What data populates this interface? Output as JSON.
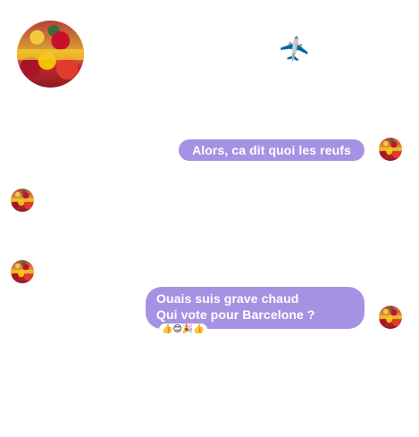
{
  "header": {
    "group_avatar": "group-photo-spain-fans",
    "status_icon": "airplane-icon",
    "status_glyph": "✈️"
  },
  "messages": [
    {
      "side": "right",
      "avatar": "user-photo-spain-fans",
      "lines": [
        "Alors, ca dit quoi les reufs"
      ]
    },
    {
      "side": "left",
      "avatar": "user-photo-spain-fans",
      "lines": []
    },
    {
      "side": "left",
      "avatar": "user-photo-spain-fans",
      "lines": []
    },
    {
      "side": "right",
      "avatar": "user-photo-spain-fans",
      "lines": [
        "Ouais suis grave chaud",
        "Qui vote pour Barcelone ?"
      ],
      "reactions": "👍😊🎉👍"
    }
  ],
  "colors": {
    "bubble_background": "#a592e3",
    "bubble_text": "#ffffff",
    "page_background": "#ffffff"
  }
}
